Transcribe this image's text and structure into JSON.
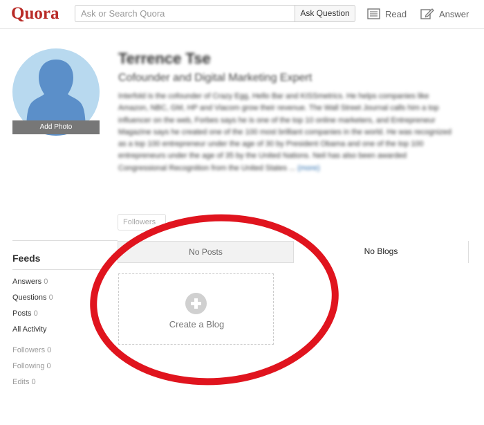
{
  "header": {
    "logo": "Quora",
    "search_placeholder": "Ask or Search Quora",
    "ask_button": "Ask Question",
    "nav_read": "Read",
    "nav_answer": "Answer"
  },
  "profile": {
    "add_photo": "Add Photo",
    "name": "Terrence Tse",
    "tagline": "Cofounder and Digital Marketing Expert",
    "bio": "Interfold is the cofounder of Crazy Egg, Hello Bar and KISSmetrics. He helps companies like Amazon, NBC, GM, HP and Viacom grow their revenue. The Wall Street Journal calls him a top influencer on the web, Forbes says he is one of the top 10 online marketers, and Entrepreneur Magazine says he created one of the 100 most brilliant companies in the world. He was recognized as a top 100 entrepreneur under the age of 30 by President Obama and one of the top 100 entrepreneurs under the age of 35 by the United Nations. Neil has also been awarded Congressional Recognition from the United States ...",
    "bio_more": "(more)",
    "followers_stub": "Followers"
  },
  "tabs": {
    "posts": "No Posts",
    "blogs": "No Blogs"
  },
  "create_blog": {
    "label": "Create a Blog"
  },
  "sidebar": {
    "title": "Feeds",
    "items": [
      {
        "label": "Answers",
        "count": "0"
      },
      {
        "label": "Questions",
        "count": "0"
      },
      {
        "label": "Posts",
        "count": "0"
      },
      {
        "label": "All Activity",
        "count": ""
      }
    ],
    "stats": [
      {
        "label": "Followers",
        "count": "0"
      },
      {
        "label": "Following",
        "count": "0"
      },
      {
        "label": "Edits",
        "count": "0"
      }
    ]
  },
  "colors": {
    "brand": "#b92b27",
    "annotation": "#e0141e",
    "avatar_bg": "#b8d9ef",
    "avatar_silhouette": "#5b8fc9"
  }
}
